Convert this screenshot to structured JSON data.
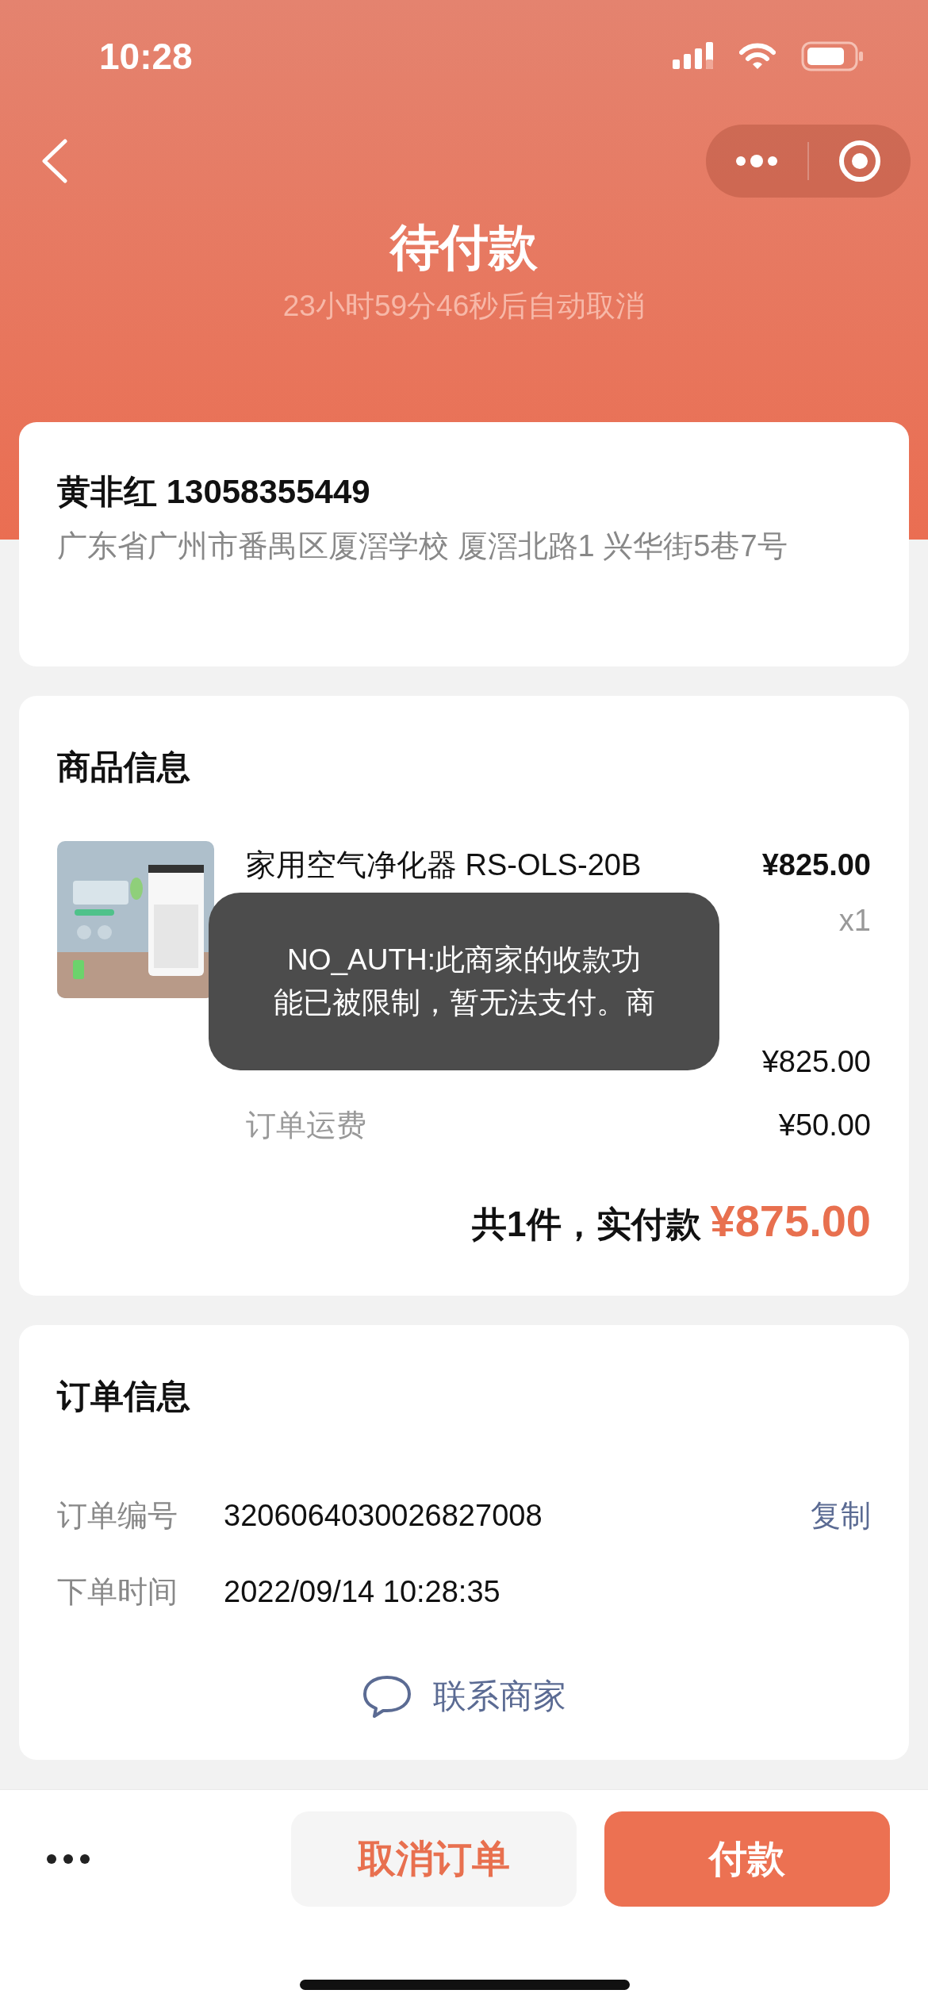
{
  "status_bar": {
    "time": "10:28"
  },
  "header": {
    "title": "待付款",
    "countdown": "23小时59分46秒后自动取消"
  },
  "address": {
    "name_phone": "黄非红 13058355449",
    "detail": "广东省广州市番禺区厦滘学校 厦滘北路1 兴华街5巷7号"
  },
  "goods": {
    "heading": "商品信息",
    "product": {
      "name": "家用空气净化器 RS-OLS-20B",
      "price": "¥825.00",
      "quantity": "x1"
    },
    "summary": [
      {
        "value": "¥825.00"
      },
      {
        "label": "订单运费",
        "value": "¥50.00"
      }
    ],
    "total_label": "共1件，实付款",
    "total": "¥875.00"
  },
  "toast": {
    "lines": [
      "NO_AUTH:此商家的收款功",
      "能已被限制，暂无法支付。商"
    ]
  },
  "order_info": {
    "heading": "订单信息",
    "rows": [
      {
        "label": "订单编号",
        "value": "3206064030026827008",
        "action": "复制"
      },
      {
        "label": "下单时间",
        "value": "2022/09/14 10:28:35"
      }
    ],
    "contact": "联系商家"
  },
  "actions": {
    "cancel": "取消订单",
    "pay": "付款"
  }
}
